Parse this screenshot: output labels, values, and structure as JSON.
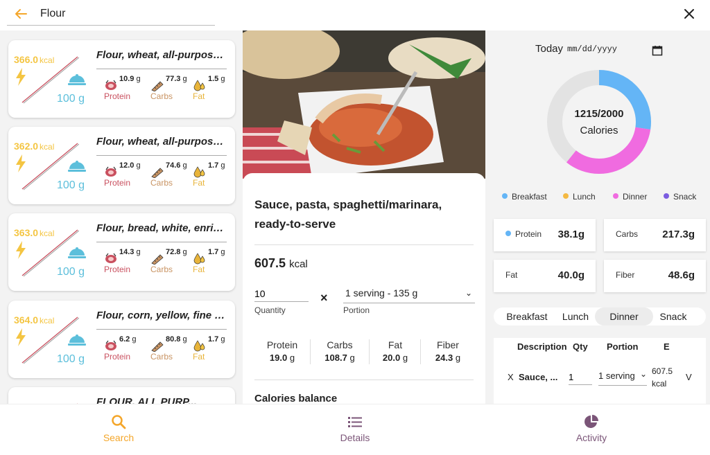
{
  "search": {
    "value": "Flour"
  },
  "foods": [
    {
      "kcal": "366.0",
      "kcal_unit": "kcal",
      "grams": "100 g",
      "title": "Flour, wheat, all-purpose, enriched, bleached",
      "protein_val": "10.9",
      "carbs_val": "77.3",
      "fat_val": "1.5",
      "unit": "g"
    },
    {
      "kcal": "362.0",
      "kcal_unit": "kcal",
      "grams": "100 g",
      "title": "Flour, wheat, all-purpose, enriched, unbleached",
      "protein_val": "12.0",
      "carbs_val": "74.6",
      "fat_val": "1.7",
      "unit": "g"
    },
    {
      "kcal": "363.0",
      "kcal_unit": "kcal",
      "grams": "100 g",
      "title": "Flour, bread, white, enriched, unbleached",
      "protein_val": "14.3",
      "carbs_val": "72.8",
      "fat_val": "1.7",
      "unit": "g"
    },
    {
      "kcal": "364.0",
      "kcal_unit": "kcal",
      "grams": "100 g",
      "title": "Flour, corn, yellow, fine meal, enriched",
      "protein_val": "6.2",
      "carbs_val": "80.8",
      "fat_val": "1.7",
      "unit": "g"
    },
    {
      "kcal": "",
      "kcal_unit": "",
      "grams": "",
      "title": "FLOUR, ALL PURP...",
      "protein_val": "",
      "carbs_val": "",
      "fat_val": "",
      "unit": ""
    }
  ],
  "macro_labels": {
    "protein": "Protein",
    "carbs": "Carbs",
    "fat": "Fat"
  },
  "details": {
    "title": "Sauce, pasta, spaghetti/marinara, ready-to-serve",
    "kcal": "607.5",
    "kcal_unit": "kcal",
    "quantity_value": "10",
    "quantity_label": "Quantity",
    "times": "×",
    "portion_value": "1 serving - 135 g",
    "portion_label": "Portion",
    "nutrients": [
      {
        "label": "Protein",
        "value": "19.0",
        "unit": "g"
      },
      {
        "label": "Carbs",
        "value": "108.7",
        "unit": "g"
      },
      {
        "label": "Fat",
        "value": "20.0",
        "unit": "g"
      },
      {
        "label": "Fiber",
        "value": "24.3",
        "unit": "g"
      }
    ],
    "balance_title": "Calories balance"
  },
  "activity": {
    "today_label": "Today",
    "date_placeholder": "mm/dd/yyyy",
    "calories_text": "1215/2000",
    "calories_label": "Calories",
    "calories_consumed": 1215,
    "calories_goal": 2000,
    "legend": [
      {
        "name": "Breakfast",
        "color": "#64b5f6"
      },
      {
        "name": "Lunch",
        "color": "#f4b942"
      },
      {
        "name": "Dinner",
        "color": "#f06be0"
      },
      {
        "name": "Snack",
        "color": "#7b5ce0"
      }
    ],
    "stats": [
      {
        "label": "Protein",
        "value": "38.1g",
        "dot_color": "#64b5f6"
      },
      {
        "label": "Carbs",
        "value": "217.3g"
      },
      {
        "label": "Fat",
        "value": "40.0g"
      },
      {
        "label": "Fiber",
        "value": "48.6g"
      }
    ],
    "meal_tabs": [
      "Breakfast",
      "Lunch",
      "Dinner",
      "Snack"
    ],
    "active_tab": "Dinner",
    "table": {
      "headers": [
        "Description",
        "Qty",
        "Portion",
        "E"
      ],
      "rows": [
        {
          "remove": "X",
          "description": "Sauce, ...",
          "qty": "1",
          "portion": "1 serving",
          "energy": "607.5",
          "energy_unit": "kcal",
          "action": "V"
        }
      ]
    }
  },
  "nav": [
    {
      "label": "Search",
      "color": "#f4a62a"
    },
    {
      "label": "Details",
      "color": "#7b5578"
    },
    {
      "label": "Activity",
      "color": "#7b5578"
    }
  ]
}
